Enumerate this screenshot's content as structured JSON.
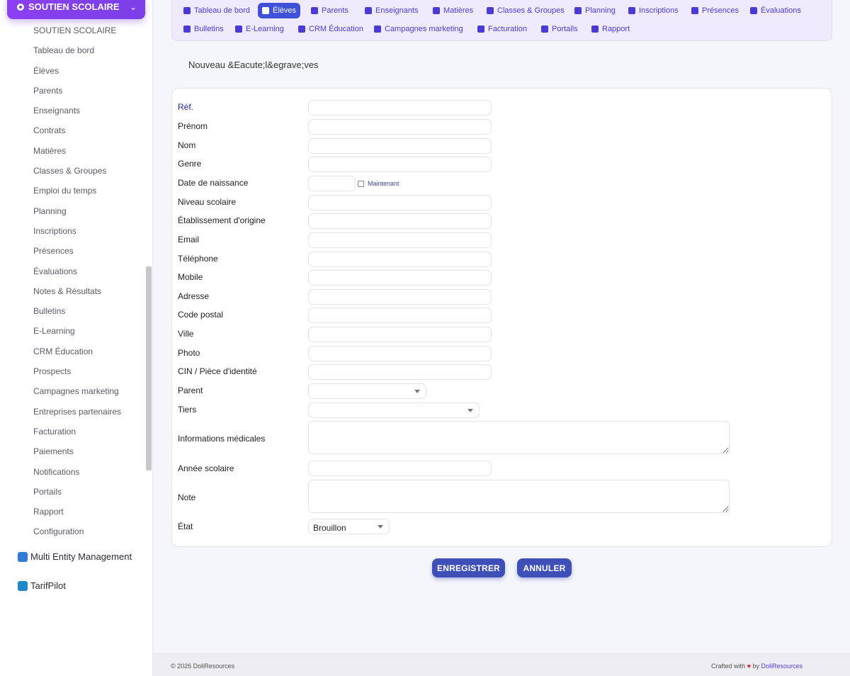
{
  "sidebar": {
    "header": "SOUTIEN SCOLAIRE",
    "items": [
      "SOUTIEN SCOLAIRE",
      "Tableau de bord",
      "Élèves",
      "Parents",
      "Enseignants",
      "Contrats",
      "Matières",
      "Classes & Groupes",
      "Emploi du temps",
      "Planning",
      "Inscriptions",
      "Présences",
      "Évaluations",
      "Notes & Résultats",
      "Bulletins",
      "E-Learning",
      "CRM Éducation",
      "Prospects",
      "Campagnes marketing",
      "Entreprises partenaires",
      "Facturation",
      "Paiements",
      "Notifications",
      "Portails",
      "Rapport",
      "Configuration"
    ],
    "modules": [
      {
        "label": "Multi Entity Management",
        "color": "#2f7bd9"
      },
      {
        "label": "TarifPilot",
        "color": "#1e88c8"
      }
    ]
  },
  "topnav": {
    "row1": [
      {
        "label": "Tableau de bord",
        "icon": "dashboard-icon",
        "active": false
      },
      {
        "label": "Élèves",
        "icon": "student-icon",
        "active": true
      },
      {
        "label": "Parents",
        "icon": "users-icon",
        "active": false
      },
      {
        "label": "Enseignants",
        "icon": "teacher-icon",
        "active": false
      },
      {
        "label": "Matières",
        "icon": "book-icon",
        "active": false
      },
      {
        "label": "Classes & Groupes",
        "icon": "layers-icon",
        "active": false
      },
      {
        "label": "Planning",
        "icon": "calendar-icon",
        "active": false
      },
      {
        "label": "Inscriptions",
        "icon": "clipboard-check-icon",
        "active": false
      },
      {
        "label": "Présences",
        "icon": "clipboard-list-icon",
        "active": false
      },
      {
        "label": "Évaluations",
        "icon": "pencil-icon",
        "active": false
      }
    ],
    "row2": [
      {
        "label": "Bulletins",
        "icon": "file-icon"
      },
      {
        "label": "E-Learning",
        "icon": "video-icon"
      },
      {
        "label": "CRM Éducation",
        "icon": "list-icon"
      },
      {
        "label": "Campagnes marketing",
        "icon": "megaphone-icon"
      },
      {
        "label": "Facturation",
        "icon": "invoice-icon"
      },
      {
        "label": "Portails",
        "icon": "user-circle-icon"
      },
      {
        "label": "Rapport",
        "icon": "pie-chart-icon"
      }
    ]
  },
  "page": {
    "title": "Nouveau &Eacute;l&egrave;ves"
  },
  "form": {
    "fields": [
      {
        "label": "Réf.",
        "type": "text",
        "value": ""
      },
      {
        "label": "Prénom",
        "type": "text",
        "value": ""
      },
      {
        "label": "Nom",
        "type": "text",
        "value": ""
      },
      {
        "label": "Genre",
        "type": "text",
        "value": ""
      },
      {
        "label": "Date de naissance",
        "type": "date",
        "value": "",
        "now_label": "Maintenant"
      },
      {
        "label": "Niveau scolaire",
        "type": "text",
        "value": ""
      },
      {
        "label": "Établissement d'origine",
        "type": "text",
        "value": ""
      },
      {
        "label": "Email",
        "type": "text",
        "value": ""
      },
      {
        "label": "Téléphone",
        "type": "text",
        "value": ""
      },
      {
        "label": "Mobile",
        "type": "text",
        "value": ""
      },
      {
        "label": "Adresse",
        "type": "text",
        "value": ""
      },
      {
        "label": "Code postal",
        "type": "text",
        "value": ""
      },
      {
        "label": "Ville",
        "type": "text",
        "value": ""
      },
      {
        "label": "Photo",
        "type": "text",
        "value": ""
      },
      {
        "label": "CIN / Pièce d'identité",
        "type": "text",
        "value": ""
      },
      {
        "label": "Parent",
        "type": "select",
        "value": ""
      },
      {
        "label": "Tiers",
        "type": "select",
        "value": ""
      },
      {
        "label": "Informations médicales",
        "type": "textarea",
        "value": ""
      },
      {
        "label": "Année scolaire",
        "type": "text",
        "value": ""
      },
      {
        "label": "Note",
        "type": "textarea",
        "value": ""
      },
      {
        "label": "État",
        "type": "select",
        "value": "Brouillon"
      }
    ],
    "save_label": "ENREGISTRER",
    "cancel_label": "ANNULER"
  },
  "footer": {
    "copyright": "© 2026 DoliResources",
    "crafted": "Crafted with",
    "heart": "♥",
    "by": "by",
    "brand": "DoliResources"
  }
}
